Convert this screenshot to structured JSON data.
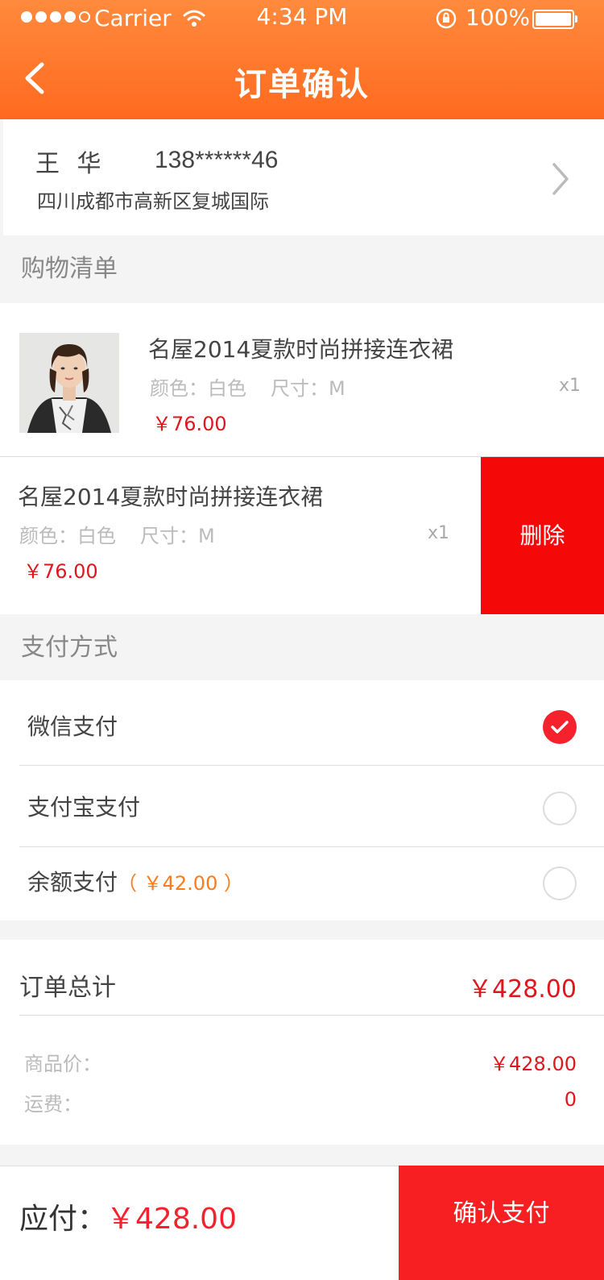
{
  "status_bar": {
    "carrier": "Carrier",
    "time": "4:34 PM",
    "battery": "100%"
  },
  "navbar": {
    "title": "订单确认",
    "back_icon": "chevron-left-icon"
  },
  "address": {
    "name": "王 华",
    "phone": "138******46",
    "detail": "四川成都市高新区复城国际",
    "arrow_icon": "chevron-right-icon"
  },
  "shopping_list": {
    "header": "购物清单",
    "items": [
      {
        "name": "名屋2014夏款时尚拼接连衣裙",
        "color": "颜色：白色",
        "size": "尺寸：M",
        "price": "￥76.00",
        "qty": "x1"
      },
      {
        "name": "名屋2014夏款时尚拼接连衣裙",
        "color": "颜色：白色",
        "size": "尺寸：M",
        "price": "￥76.00",
        "qty": "x1",
        "delete_label": "删除"
      }
    ]
  },
  "payment": {
    "header": "支付方式",
    "options": [
      {
        "label": "微信支付",
        "extra": "",
        "selected": true
      },
      {
        "label": "支付宝支付",
        "extra": "",
        "selected": false
      },
      {
        "label": "余额支付",
        "extra": "（ ￥42.00 ）",
        "selected": false
      }
    ]
  },
  "summary": {
    "total_label": "订单总计",
    "total_value": "￥428.00",
    "goods_label": "商品价：",
    "goods_value": "￥428.00",
    "shipping_label": "运费：",
    "shipping_value": "0"
  },
  "bottom": {
    "payable_label": "应付：",
    "payable_value": "￥428.00",
    "confirm_label": "确认支付"
  },
  "colors": {
    "header_orange": "#ff7a2a",
    "accent_red": "#f5222d",
    "balance_orange": "#ff7a1a"
  }
}
